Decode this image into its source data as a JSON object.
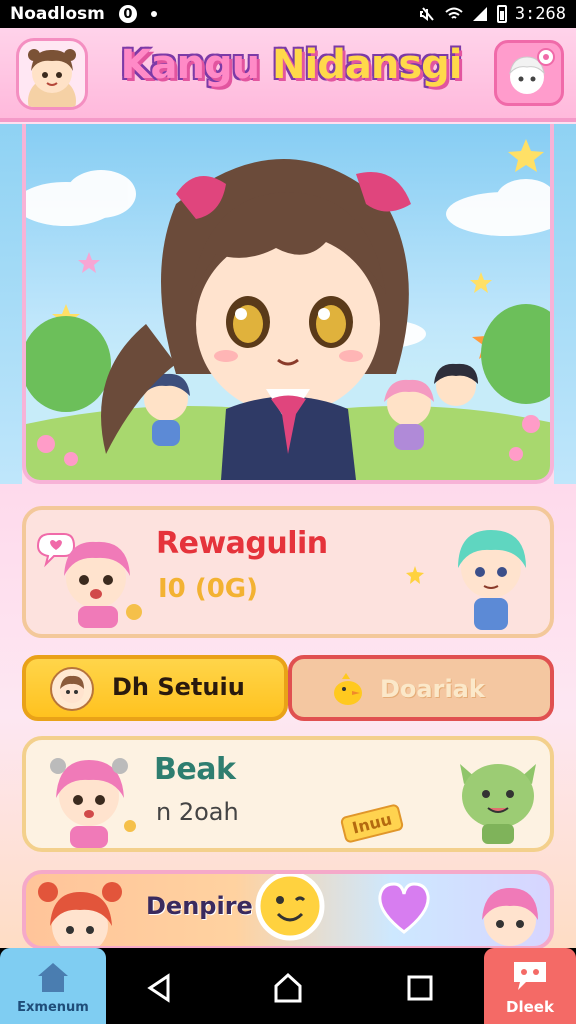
{
  "status_bar": {
    "carrier": "Noadlosm",
    "badge": "0",
    "time": "3:268"
  },
  "header": {
    "title_part1": "Kangu",
    "title_part2": "Nidansgi",
    "avatar_icon": "girl-avatar-icon",
    "profile_icon": "profile-icon"
  },
  "hero": {
    "scene": "anime-girl-hero-scene"
  },
  "cards": {
    "reward": {
      "title": "Rewagulin",
      "subtitle": "I0 (0G)"
    },
    "break": {
      "title": "Beak",
      "subtitle": "n 2oah",
      "tag": "Inuu"
    },
    "bottom": {
      "title": "Denpire"
    }
  },
  "buttons": {
    "settings": {
      "label": "Dh Setuiu"
    },
    "dark": {
      "label": "Doariak"
    }
  },
  "nav": {
    "home_label": "Exmenum",
    "right_label": "Dleek"
  },
  "colors": {
    "header_pink": "#ffb9dc",
    "reward_title": "#e5333b",
    "break_title": "#2e7e70",
    "settings_yellow": "#ffc21f",
    "nav_home": "#7fcdf2",
    "nav_right": "#f46a66"
  }
}
